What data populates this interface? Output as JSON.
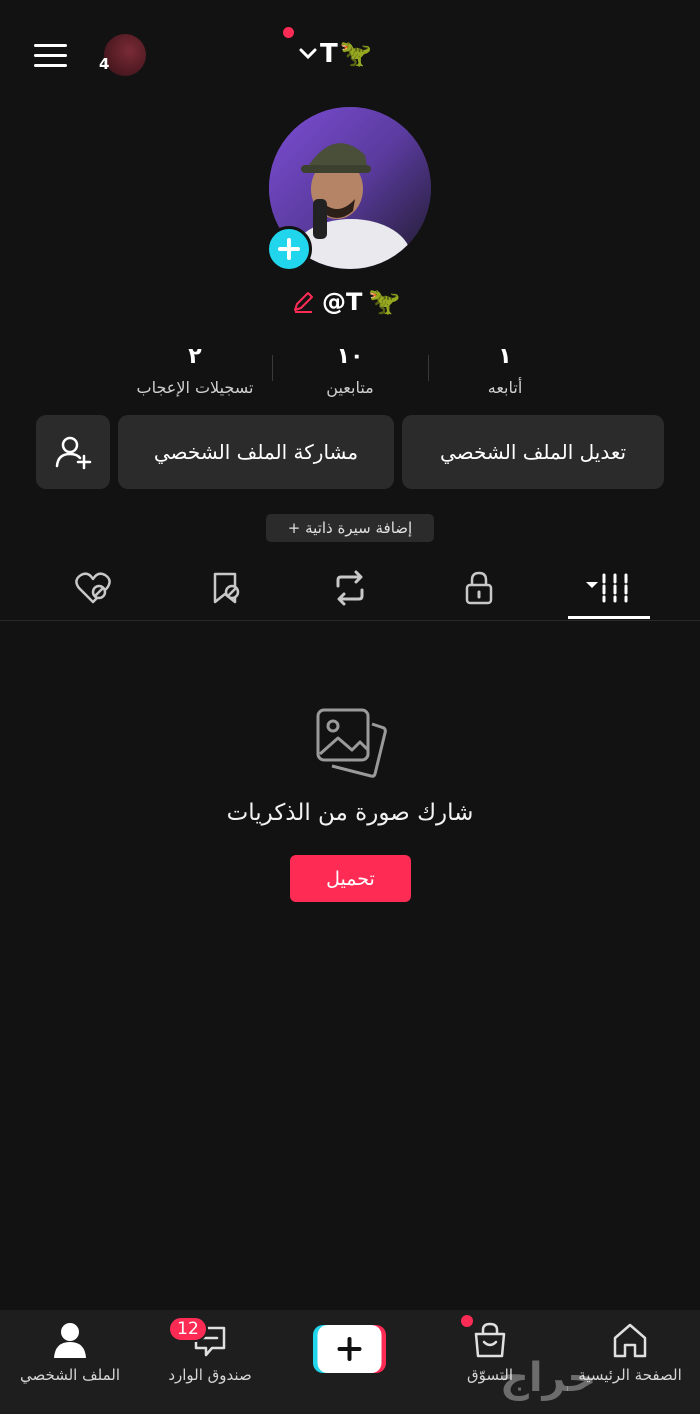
{
  "header": {
    "story_count": "4",
    "username": "T",
    "emoji": "🦖"
  },
  "profile": {
    "handle": "@T",
    "emoji": "🦖"
  },
  "stats": [
    {
      "value": "٢",
      "label": "تسجيلات الإعجاب"
    },
    {
      "value": "١٠",
      "label": "متابعين"
    },
    {
      "value": "١",
      "label": "أتابعه"
    }
  ],
  "buttons": {
    "edit_profile": "تعديل الملف الشخصي",
    "share_profile": "مشاركة الملف الشخصي"
  },
  "bio_chip": "+ إضافة سيرة ذاتية",
  "tabs": [
    {
      "icon": "liked-heart-icon"
    },
    {
      "icon": "favorites-icon"
    },
    {
      "icon": "repost-icon"
    },
    {
      "icon": "lock-icon"
    },
    {
      "icon": "videos-grid-icon",
      "active": true
    }
  ],
  "empty_state": {
    "title": "شارك صورة من الذكريات",
    "button": "تحميل"
  },
  "bottom_nav": {
    "profile": "الملف الشخصي",
    "inbox": "صندوق الوارد",
    "inbox_badge": "12",
    "shop": "التسوّق",
    "home": "الصفحة الرئيسية"
  },
  "watermark": "حراج",
  "colors": {
    "accent": "#fe2c55",
    "cyan": "#20d5ec",
    "background": "#121212"
  }
}
